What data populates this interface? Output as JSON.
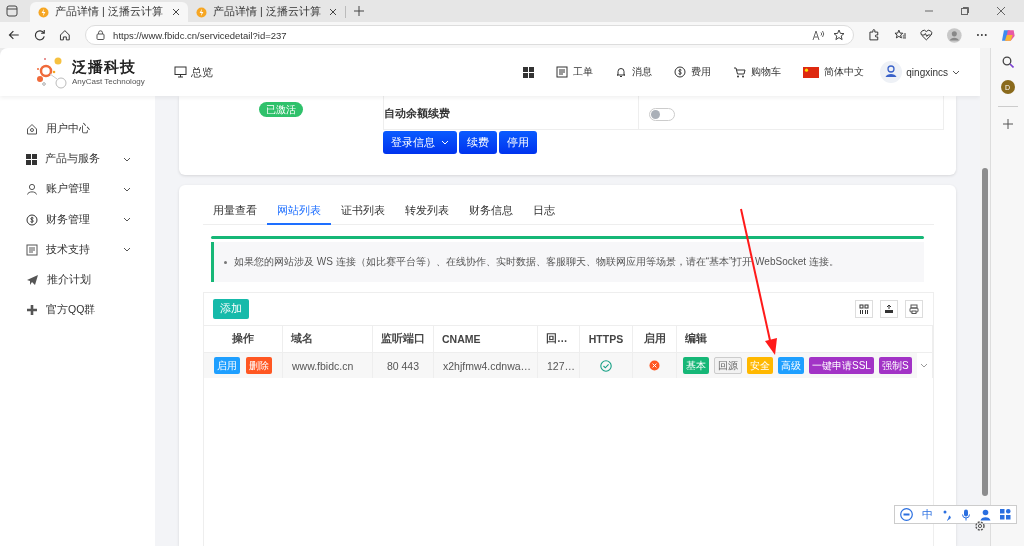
{
  "browser": {
    "tabs": [
      {
        "title": "产品详情 | 泛播云计算",
        "selected": true
      },
      {
        "title": "产品详情 | 泛播云计算",
        "selected": false
      }
    ],
    "url": "https://www.fbidc.cn/servicedetail?id=237",
    "profile_initial": "D"
  },
  "header": {
    "brand": "泛播科技",
    "tagline": "AnyCast Technology",
    "overview": "总览",
    "nav": [
      {
        "kind": "grid"
      },
      {
        "kind": "ticket",
        "label": "工单"
      },
      {
        "kind": "bell",
        "label": "消息"
      },
      {
        "kind": "money",
        "label": "费用"
      },
      {
        "kind": "cart",
        "label": "购物车"
      },
      {
        "kind": "flag",
        "label": "简体中文"
      },
      {
        "kind": "user",
        "label": "qingxincs"
      }
    ]
  },
  "sidebar": {
    "items": [
      {
        "label": "用户中心",
        "kind": "link"
      },
      {
        "label": "产品与服务",
        "kind": "group"
      },
      {
        "label": "账户管理",
        "kind": "group"
      },
      {
        "label": "财务管理",
        "kind": "group"
      },
      {
        "label": "技术支持",
        "kind": "group"
      },
      {
        "label": "推介计划",
        "kind": "link"
      },
      {
        "label": "官方QQ群",
        "kind": "link"
      }
    ]
  },
  "service_card": {
    "status": "已激活",
    "settings": [
      {
        "label": "自动余额续费",
        "on": false
      }
    ],
    "buttons": [
      {
        "label": "登录信息",
        "dropdown": true
      },
      {
        "label": "续费",
        "dropdown": false
      },
      {
        "label": "停用",
        "dropdown": false
      }
    ]
  },
  "tabs": [
    {
      "label": "用量查看",
      "selected": false
    },
    {
      "label": "网站列表",
      "selected": true
    },
    {
      "label": "证书列表",
      "selected": false
    },
    {
      "label": "转发列表",
      "selected": false
    },
    {
      "label": "财务信息",
      "selected": false
    },
    {
      "label": "日志",
      "selected": false
    }
  ],
  "notice": "如果您的网站涉及 WS 连接（如比赛平台等）、在线协作、实时数据、客服聊天、物联网应用等场景，请在“基本”打开 WebSocket 连接。",
  "table": {
    "add_button": "添加",
    "columns": [
      "操作",
      "域名",
      "监听端口",
      "CNAME",
      "回…",
      "HTTPS",
      "启用",
      "编辑"
    ],
    "rows": [
      {
        "actions": [
          {
            "label": "启用",
            "color": "#1e9fff"
          },
          {
            "label": "删除",
            "color": "#ff5722"
          }
        ],
        "domain": "www.fbidc.cn",
        "port": "80 443",
        "cname": "x2hjfmw4.cdnwa…",
        "column_5": "127…",
        "https": true,
        "enabled": false,
        "edit": [
          {
            "label": "基本",
            "color": "#16b777"
          },
          {
            "label": "回源",
            "color": "#f2f2f2"
          },
          {
            "label": "安全",
            "color": "#ffb800"
          },
          {
            "label": "高级",
            "color": "#1e9fff"
          },
          {
            "label": "一键申请SSL",
            "color": "#a233c6"
          },
          {
            "label": "强制S",
            "color": "#a233c6"
          }
        ]
      }
    ]
  },
  "ime": {
    "label": "中"
  }
}
